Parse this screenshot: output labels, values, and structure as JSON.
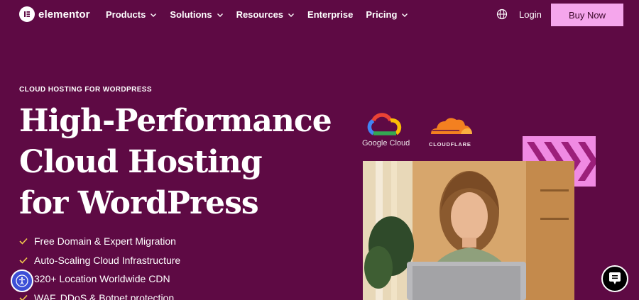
{
  "nav": {
    "logo_text": "elementor",
    "items": [
      {
        "label": "Products",
        "dropdown": true
      },
      {
        "label": "Solutions",
        "dropdown": true
      },
      {
        "label": "Resources",
        "dropdown": true
      },
      {
        "label": "Enterprise",
        "dropdown": false
      },
      {
        "label": "Pricing",
        "dropdown": true
      }
    ],
    "login_label": "Login",
    "buy_label": "Buy Now"
  },
  "hero": {
    "eyebrow": "CLOUD HOSTING FOR WORDPRESS",
    "headline_lines": [
      "High-Performance",
      "Cloud Hosting",
      "for WordPress"
    ],
    "features": [
      "Free Domain & Expert Migration",
      "Auto-Scaling Cloud Infrastructure",
      "320+ Location Worldwide CDN",
      "WAF, DDoS & Botnet protection"
    ]
  },
  "partners": {
    "google_cloud": "Google Cloud",
    "cloudflare": "CLOUDFLARE"
  },
  "colors": {
    "background": "#5e0a44",
    "accent_pink": "#f5a6ec",
    "check_yellow": "#f2c94c",
    "a11y_blue": "#3d4fd6"
  },
  "icons": {
    "logo": "elementor-logo-icon",
    "language": "globe-icon",
    "accessibility": "accessibility-icon",
    "chat": "chat-icon"
  }
}
